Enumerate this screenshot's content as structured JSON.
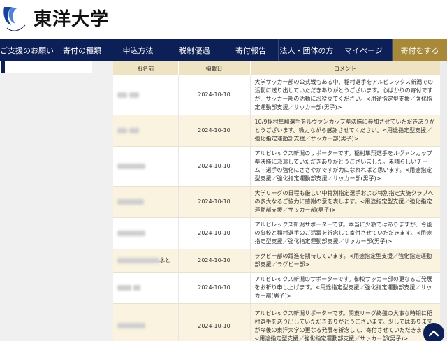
{
  "brand": {
    "name": "東洋大学",
    "logo_arc_text": "TOYO UNIVERSITY",
    "primary": "#0c1f57",
    "accent": "#a8893a"
  },
  "nav": [
    {
      "label": "ご支援のお願い"
    },
    {
      "label": "寄付の種類"
    },
    {
      "label": "申込方法"
    },
    {
      "label": "税制優遇"
    },
    {
      "label": "寄付報告"
    },
    {
      "label": "法人・団体の方"
    },
    {
      "label": "マイページ"
    },
    {
      "label": "寄付をする"
    }
  ],
  "table": {
    "headers": [
      "お名前",
      "掲載日",
      "コメント"
    ],
    "rows": [
      {
        "name": "",
        "date": "2024-10-10",
        "comment": "大学サッカー部の公式戦もある中、稲村選手をアルビレックス新潟での活動に送り出していただきありがとうございます。心ばかりの寄付ですが、サッカー部の活動にお役立てください。<用途指定型支援／強化指定運動部支援／サッカー部(男子)>"
      },
      {
        "name": "",
        "date": "2024-10-10",
        "comment": "10/9稲村隼翔選手をルヴァンカップ準決勝に参加させていただきありがとうございます。微力ながら感謝させてください。<用途指定型支援／強化指定運動部支援／サッカー部(男子)>"
      },
      {
        "name": "",
        "date": "2024-10-10",
        "comment": "アルビレックス新潟のサポーターです。稲村隼翔選手をルヴァンカップ準決勝に派遣していただきありがとうございました。素晴らしいチーム・選手の強化にささやかですが力になれればと思います。<用途指定型支援／強化指定運動部支援／サッカー部(男子)>"
      },
      {
        "name": "",
        "date": "2024-10-10",
        "comment": "大学リーグの日程も厳しい中特別指定選手および特別指定実施クラブへの多大なるご協力に感謝の意を表します。<用途指定型支援／強化指定運動部支援／サッカー部(男子)>"
      },
      {
        "name": "",
        "date": "2024-10-10",
        "comment": "アルビレックス新潟サポーターです。本当に少額ではありますが、今後の御校と稲村選手のご活躍を祈念して寄付させていただきます。<用途指定型支援／強化指定運動部支援／サッカー部(男子)>"
      },
      {
        "name": "水と",
        "date": "2024-10-10",
        "comment": "ラグビー部の躍進を期待しています。<用途指定型支援／強化指定運動部支援／ラグビー部>"
      },
      {
        "name": "",
        "date": "2024-10-10",
        "comment": "アルビレックス新潟のサポーターです。御校サッカー部の更なるご発展をお祈り申し上げます。<用途指定型支援／強化指定運動部支援／サッカー部(男子)>"
      },
      {
        "name": "",
        "date": "2024-10-10",
        "comment": "アルビレックス新潟サポーターです。関東リーグ終盤の大事な時期に稲村選手を送り出していただきありがとうございます。少しではありますが今後の東洋大学の更なる発展を祈念して、寄付させていただきます。<用途指定型支援／強化指定運動部支援／サッカー部(男子)>"
      }
    ]
  },
  "to_top_icon": "chevron-up-icon"
}
